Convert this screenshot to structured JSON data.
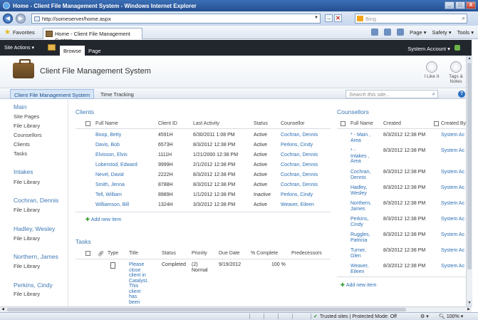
{
  "window": {
    "title": "Home - Client File Management System - Windows Internet Explorer",
    "buttons": [
      "_",
      "□",
      "X"
    ]
  },
  "addressbar": {
    "url": "http://someserver/home.aspx",
    "search_placeholder": "Bing"
  },
  "favbar": {
    "favorites_label": "Favorites",
    "tab_label": "Home - Client File Management System",
    "commands": [
      "Page ▾",
      "Safety ▾",
      "Tools ▾"
    ]
  },
  "spribbon": {
    "site_actions": "Site Actions ▾",
    "tab_browse": "Browse",
    "tab_page": "Page",
    "account": "System Account ▾"
  },
  "header": {
    "site_title": "Client File Management System",
    "like_label": "I Like It",
    "tags_label1": "Tags &",
    "tags_label2": "Notes"
  },
  "topnav": {
    "selected": "Client File Management System",
    "item": "Time Tracking",
    "search_placeholder": "Search this site..."
  },
  "leftnav": {
    "items": [
      {
        "label": "Main",
        "heading": true
      },
      {
        "label": "Site Pages",
        "heading": false
      },
      {
        "label": "File Library",
        "heading": false
      },
      {
        "label": "Counsellors",
        "heading": false
      },
      {
        "label": "Clients",
        "heading": false
      },
      {
        "label": "Tasks",
        "heading": false
      },
      {
        "label": "Intakes",
        "heading": true
      },
      {
        "label": "File Library",
        "heading": false
      },
      {
        "label": "Cochran, Dennis",
        "heading": true
      },
      {
        "label": "File Library",
        "heading": false
      },
      {
        "label": "Hadley, Wesley",
        "heading": true
      },
      {
        "label": "File Library",
        "heading": false
      },
      {
        "label": "Northern, James",
        "heading": true
      },
      {
        "label": "File Library",
        "heading": false
      },
      {
        "label": "Perkins, Cindy",
        "heading": true
      },
      {
        "label": "File Library",
        "heading": false
      }
    ]
  },
  "clients": {
    "title": "Clients",
    "columns": [
      "Full Name",
      "Client ID",
      "Last Activity",
      "Status",
      "Counsellor"
    ],
    "rows": [
      [
        "Boop, Betty",
        "4591H",
        "6/30/2011 1:08 PM",
        "Active",
        "Cochran, Dennis"
      ],
      [
        "Davis, Bob",
        "6573H",
        "8/3/2012 12:38 PM",
        "Active",
        "Perkins, Cindy"
      ],
      [
        "Elvisson, Elvis",
        "1111H",
        "1/21/2000 12:38 PM",
        "Active",
        "Cochran, Dennis"
      ],
      [
        "Loberstod, Edward",
        "9999H",
        "2/1/2012 12:38 PM",
        "Active",
        "Cochran, Dennis"
      ],
      [
        "Nevel, David",
        "2222H",
        "8/3/2012 12:38 PM",
        "Active",
        "Cochran, Dennis"
      ],
      [
        "Smith, Jenna",
        "8788H",
        "8/3/2012 12:38 PM",
        "Active",
        "Cochran, Dennis"
      ],
      [
        "Tell, William",
        "8989H",
        "1/1/2012 12:38 PM",
        "Inactive",
        "Perkins, Cindy"
      ],
      [
        "Williamson, Bill",
        "1324H",
        "3/3/2012 12:38 PM",
        "Active",
        "Weaver, Eileen"
      ]
    ],
    "add_new": "Add new item"
  },
  "tasks": {
    "title": "Tasks",
    "columns": [
      "Type",
      "Title",
      "Status",
      "Priority",
      "Due Date",
      "% Complete",
      "Predecessors"
    ],
    "row": {
      "title_lines": [
        "Please",
        "close",
        "client in",
        "Catalyst.",
        "This",
        "client",
        "has",
        "been"
      ],
      "status": "Completed",
      "priority_line1": "(2)",
      "priority_line2": "Normal",
      "due": "9/19/2012",
      "complete": "100 %"
    }
  },
  "counsellors": {
    "title": "Counsellors",
    "columns": [
      "Full Name",
      "Created",
      "Created By"
    ],
    "rows": [
      {
        "name_lines": [
          "* - Main ,",
          "Area"
        ],
        "created": "8/3/2012 12:38 PM",
        "by": "System Ac"
      },
      {
        "name_lines": [
          "* -",
          "Intakes ,",
          "Area"
        ],
        "created": "8/3/2012 12:38 PM",
        "by": "System Ac"
      },
      {
        "name_lines": [
          "Cochran,",
          "Dennis"
        ],
        "created": "8/3/2012 12:38 PM",
        "by": "System Ac"
      },
      {
        "name_lines": [
          "Hadley,",
          "Wesley"
        ],
        "created": "8/3/2012 12:38 PM",
        "by": "System Ac"
      },
      {
        "name_lines": [
          "Northern,",
          "James"
        ],
        "created": "8/3/2012 12:38 PM",
        "by": "System Ac"
      },
      {
        "name_lines": [
          "Perkins,",
          "Cindy"
        ],
        "created": "8/3/2012 12:38 PM",
        "by": "System Ac"
      },
      {
        "name_lines": [
          "Ruggles,",
          "Patricia"
        ],
        "created": "8/3/2012 12:38 PM",
        "by": "System Ac"
      },
      {
        "name_lines": [
          "Turner,",
          "Glen"
        ],
        "created": "8/3/2012 12:38 PM",
        "by": "System Ac"
      },
      {
        "name_lines": [
          "Weaver,",
          "Eileen"
        ],
        "created": "8/3/2012 12:38 PM",
        "by": "System Ac"
      }
    ],
    "add_new": "Add new item"
  },
  "statusbar": {
    "trusted": "Trusted sites | Protected Mode: Off",
    "zoom": "100%"
  }
}
